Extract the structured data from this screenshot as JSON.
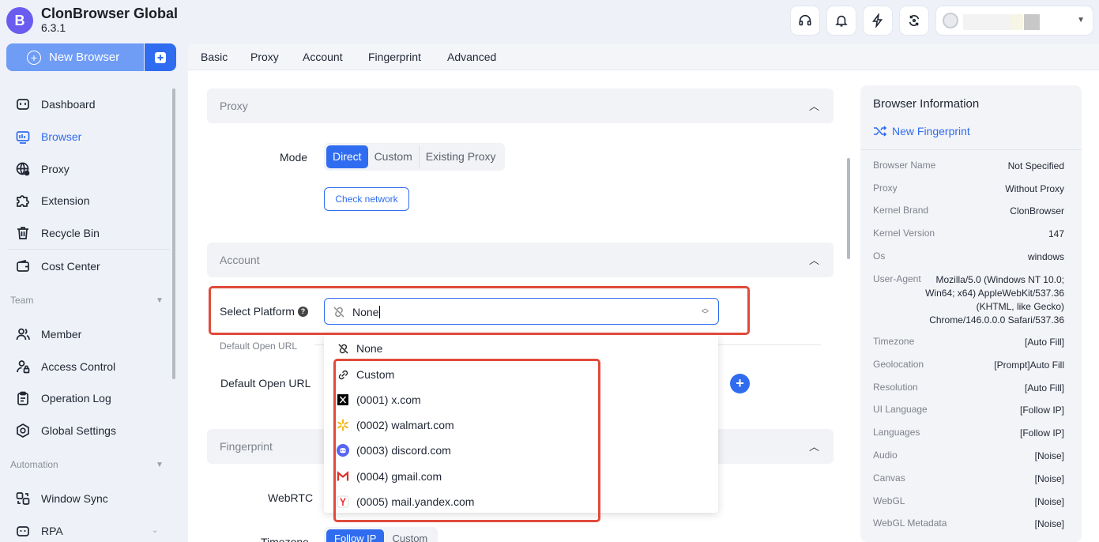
{
  "app": {
    "name": "ClonBrowser Global",
    "version": "6.3.1",
    "logo_letter": "B"
  },
  "topbar": {
    "icons": [
      "headset-icon",
      "bell-icon",
      "bolt-icon",
      "sync-icon"
    ]
  },
  "sidebar": {
    "new_browser_label": "New Browser",
    "items": [
      {
        "label": "Dashboard",
        "icon": "dashboard-icon"
      },
      {
        "label": "Browser",
        "icon": "browser-icon",
        "active": true
      },
      {
        "label": "Proxy",
        "icon": "globe-icon"
      },
      {
        "label": "Extension",
        "icon": "puzzle-icon"
      },
      {
        "label": "Recycle Bin",
        "icon": "trash-icon"
      },
      {
        "label": "Cost Center",
        "icon": "wallet-icon"
      }
    ],
    "team_label": "Team",
    "team_items": [
      {
        "label": "Member",
        "icon": "users-icon"
      },
      {
        "label": "Access Control",
        "icon": "user-lock-icon"
      },
      {
        "label": "Operation Log",
        "icon": "clipboard-icon"
      },
      {
        "label": "Global Settings",
        "icon": "settings-icon"
      }
    ],
    "automation_label": "Automation",
    "automation_items": [
      {
        "label": "Window Sync",
        "icon": "window-sync-icon"
      },
      {
        "label": "RPA",
        "icon": "robot-icon"
      }
    ]
  },
  "tabs": [
    "Basic",
    "Proxy",
    "Account",
    "Fingerprint",
    "Advanced"
  ],
  "proxy_section": {
    "title": "Proxy",
    "mode_label": "Mode",
    "modes": [
      "Direct",
      "Custom",
      "Existing Proxy"
    ],
    "selected_mode": "Direct",
    "check_network_label": "Check network"
  },
  "account_section": {
    "title": "Account",
    "select_platform_label": "Select Platform",
    "selected_platform": "None",
    "default_open_url_hint": "Default Open URL",
    "default_open_url_label": "Default Open URL"
  },
  "fingerprint_section": {
    "title": "Fingerprint",
    "webrtc_label": "WebRTC",
    "timezone_label": "Timezone",
    "timezone_options": [
      "Follow IP",
      "Custom"
    ]
  },
  "platform_dropdown": {
    "options": [
      {
        "label": "None",
        "icon": "unlink-icon"
      },
      {
        "label": "Custom",
        "icon": "link-icon"
      },
      {
        "label": "(0001) x.com",
        "icon": "x-logo-icon"
      },
      {
        "label": "(0002) walmart.com",
        "icon": "walmart-logo-icon"
      },
      {
        "label": "(0003) discord.com",
        "icon": "discord-logo-icon"
      },
      {
        "label": "(0004) gmail.com",
        "icon": "gmail-logo-icon"
      },
      {
        "label": "(0005) mail.yandex.com",
        "icon": "yandex-logo-icon"
      }
    ]
  },
  "browser_info": {
    "title": "Browser Information",
    "new_fingerprint_label": "New Fingerprint",
    "rows": [
      {
        "key": "Browser Name",
        "value": "Not Specified"
      },
      {
        "key": "Proxy",
        "value": "Without Proxy"
      },
      {
        "key": "Kernel Brand",
        "value": "ClonBrowser"
      },
      {
        "key": "Kernel Version",
        "value": "147"
      },
      {
        "key": "Os",
        "value": "windows"
      },
      {
        "key": "User-Agent",
        "value": "Mozilla/5.0 (Windows NT 10.0; Win64; x64) AppleWebKit/537.36 (KHTML, like Gecko) Chrome/146.0.0.0 Safari/537.36"
      },
      {
        "key": "Timezone",
        "value": "[Auto Fill]"
      },
      {
        "key": "Geolocation",
        "value": "[Prompt]Auto Fill"
      },
      {
        "key": "Resolution",
        "value": "[Auto Fill]"
      },
      {
        "key": "UI Language",
        "value": "[Follow IP]"
      },
      {
        "key": "Languages",
        "value": "[Follow IP]"
      },
      {
        "key": "Audio",
        "value": "[Noise]"
      },
      {
        "key": "Canvas",
        "value": "[Noise]"
      },
      {
        "key": "WebGL",
        "value": "[Noise]"
      },
      {
        "key": "WebGL Metadata",
        "value": "[Noise]"
      }
    ]
  },
  "colors": {
    "accent": "#2f6cf0",
    "highlight": "#e04a3a",
    "logo": "#6b5cf0"
  }
}
